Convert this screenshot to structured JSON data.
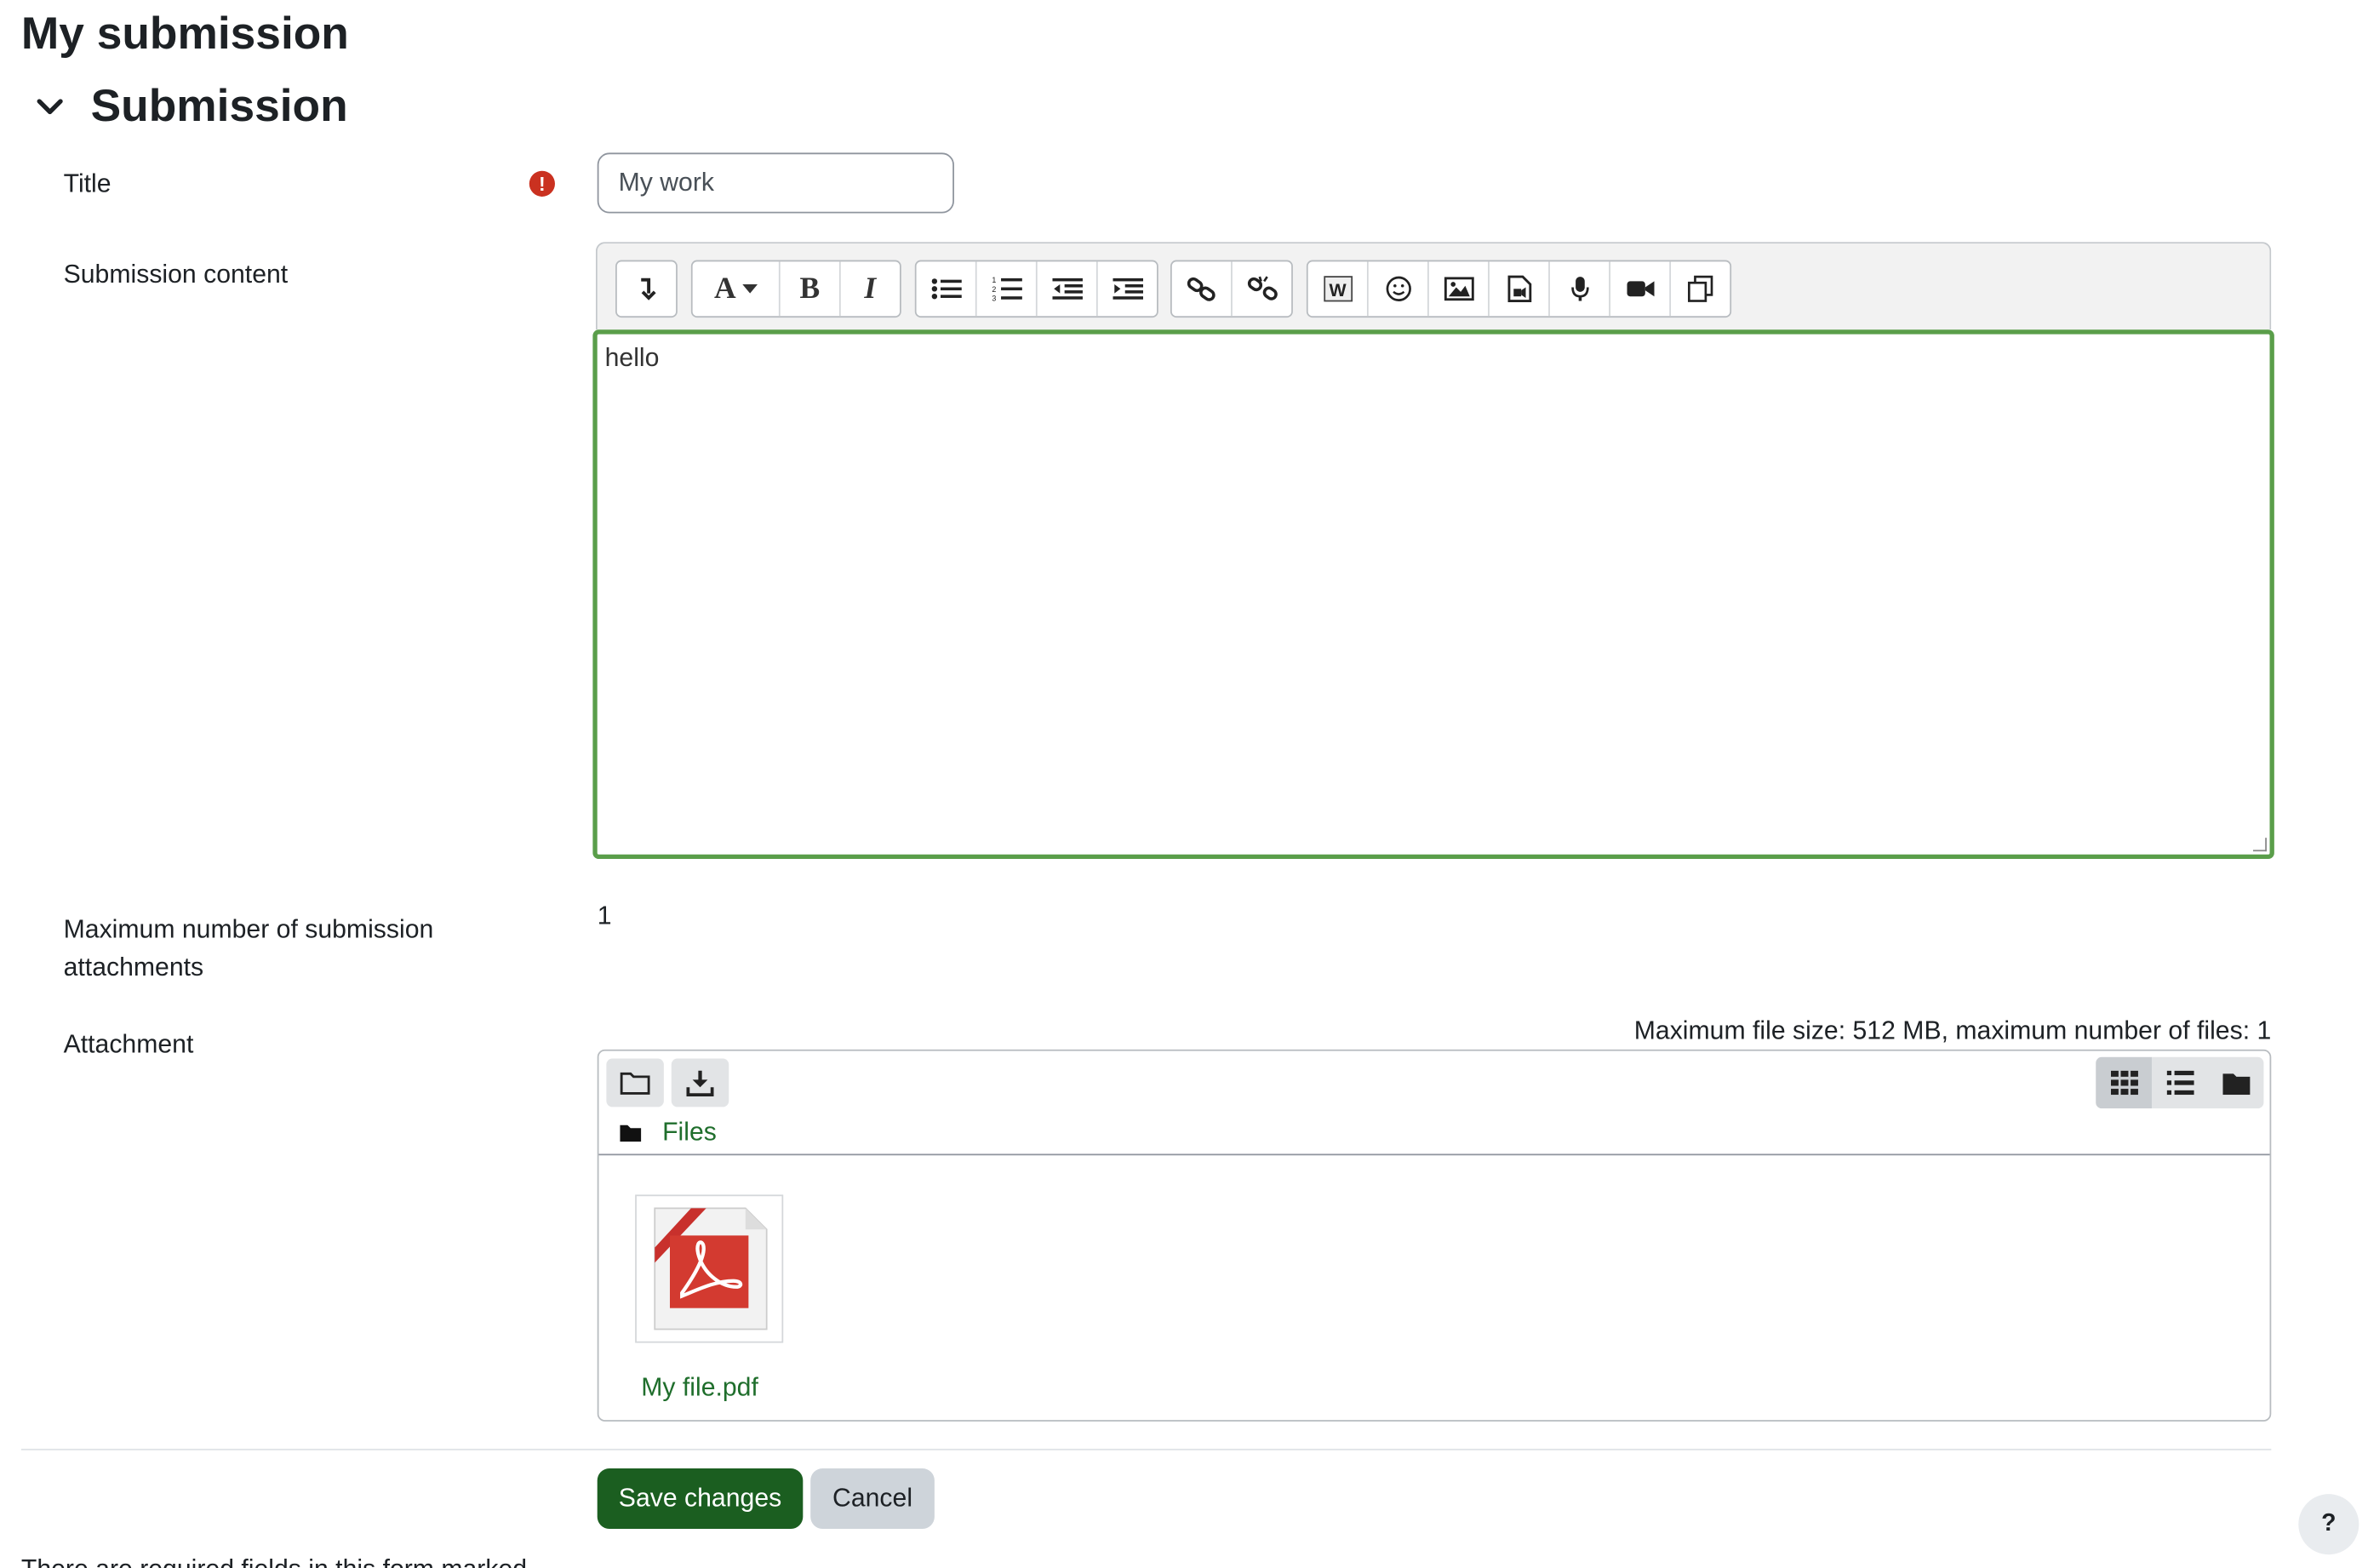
{
  "page": {
    "title": "My submission"
  },
  "section": {
    "title": "Submission"
  },
  "fields": {
    "title_label": "Title",
    "title_value": "My work",
    "content_label": "Submission content",
    "content_text": "hello",
    "max_attach_label": "Maximum number of submission attachments",
    "max_attach_value": "1",
    "attachment_label": "Attachment"
  },
  "editor_toolbar": {
    "groups": [
      [
        "collapse-icon"
      ],
      [
        "font-style-icon",
        "bold-icon",
        "italic-icon"
      ],
      [
        "unordered-list-icon",
        "ordered-list-icon",
        "outdent-icon",
        "indent-icon"
      ],
      [
        "link-icon",
        "unlink-icon"
      ],
      [
        "word-import-icon",
        "emoji-icon",
        "image-icon",
        "media-icon",
        "record-audio-icon",
        "record-video-icon",
        "manage-files-icon"
      ]
    ]
  },
  "filemanager": {
    "limits": "Maximum file size: 512 MB, maximum number of files: 1",
    "breadcrumb": "Files",
    "files": [
      {
        "name": "My file.pdf",
        "type": "pdf"
      }
    ]
  },
  "buttons": {
    "save": "Save changes",
    "cancel": "Cancel",
    "help": "?"
  },
  "footnote": "There are required fields in this form marked",
  "colors": {
    "primary": "#1b5e20",
    "required": "#ca3120",
    "focus_border": "#5a9e4a",
    "link": "#1f6e2c"
  }
}
